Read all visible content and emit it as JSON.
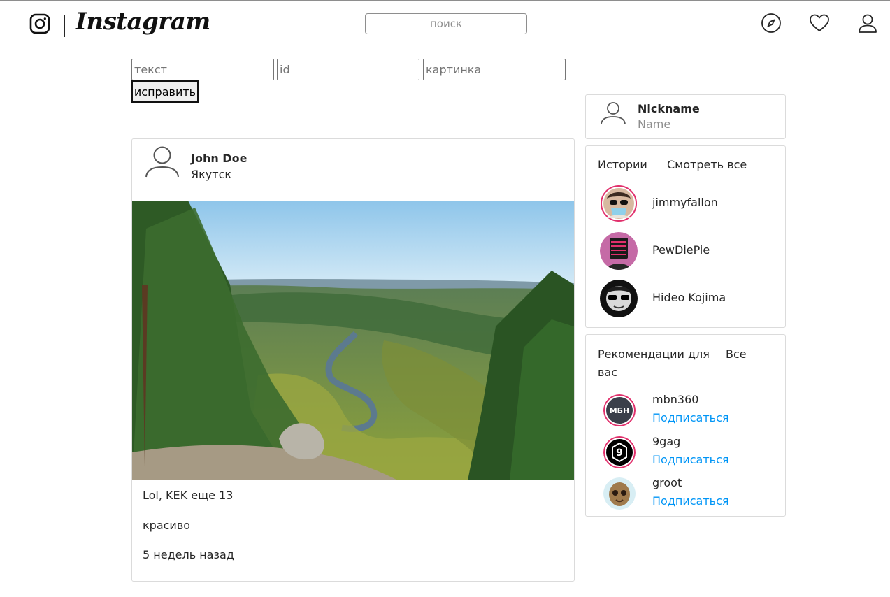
{
  "header": {
    "brand": "Instagram",
    "search_placeholder": "поиск",
    "icons": [
      "instagram-camera-icon",
      "compass-icon",
      "heart-icon",
      "user-icon"
    ]
  },
  "edit_form": {
    "text_placeholder": "текст",
    "id_placeholder": "id",
    "image_placeholder": "картинка",
    "submit_label": "исправить"
  },
  "post": {
    "author": "John Doe",
    "location": "Якутск",
    "caption": "Lol, KEK еще 13",
    "comment": "красиво",
    "time_ago": "5 недель назад"
  },
  "profile": {
    "nickname": "Nickname",
    "name": "Name"
  },
  "stories": {
    "title": "Истории",
    "see_all": "Смотреть все",
    "items": [
      {
        "name": "jimmyfallon"
      },
      {
        "name": "PewDiePie"
      },
      {
        "name": "Hideo Kojima"
      }
    ]
  },
  "recommendations": {
    "title": "Рекомендации для вас",
    "all": "Все",
    "items": [
      {
        "name": "mbn360",
        "action": "Подписаться",
        "avatar_text": "МБН"
      },
      {
        "name": "9gag",
        "action": "Подписаться",
        "avatar_text": "9"
      },
      {
        "name": "groot",
        "action": "Подписаться"
      }
    ]
  },
  "colors": {
    "link": "#0095f6",
    "border": "#dbdbdb",
    "text": "#262626",
    "muted": "#8e8e8e"
  }
}
